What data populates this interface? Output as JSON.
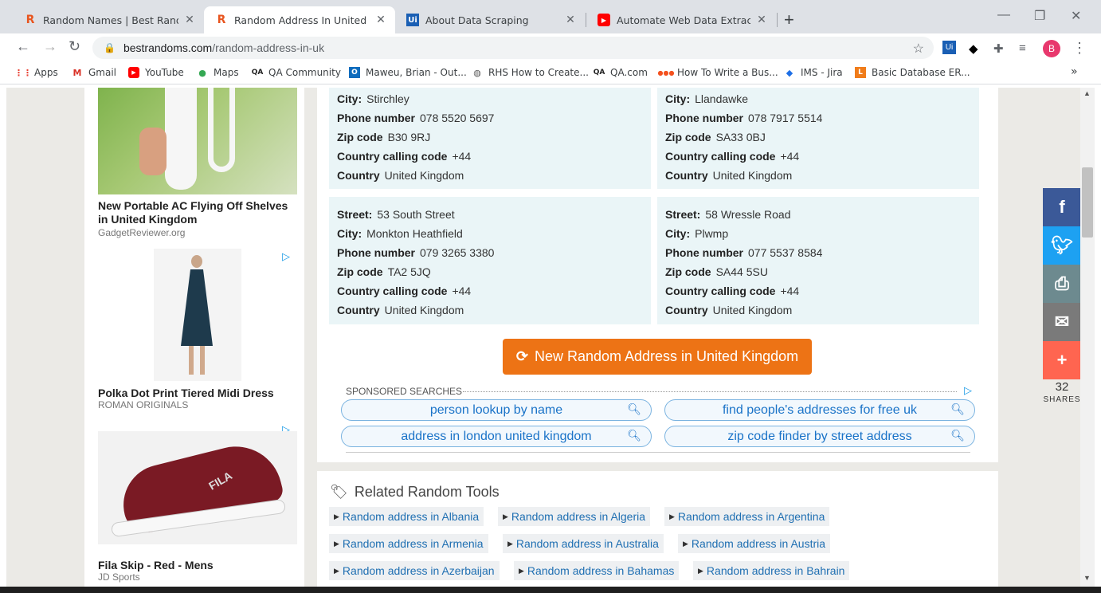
{
  "tabs": [
    {
      "favicon": "R",
      "title": "Random Names | Best Random T",
      "close": "✕"
    },
    {
      "favicon": "R",
      "title": "Random Address In United Kingd",
      "close": "✕"
    },
    {
      "favicon": "Ui",
      "title": "About Data Scraping",
      "close": "✕"
    },
    {
      "favicon": "▶",
      "title": "Automate Web Data Extraction -",
      "close": "✕"
    }
  ],
  "new_tab": "+",
  "window_controls": {
    "minimize": "—",
    "maximize": "❐",
    "close": "✕"
  },
  "address": {
    "host": "bestrandoms.com",
    "path": "/random-address-in-uk"
  },
  "bookmarks": [
    {
      "icon": "apps-icon",
      "label": "Apps"
    },
    {
      "icon": "gmail-icon",
      "label": "Gmail"
    },
    {
      "icon": "youtube-icon",
      "label": "YouTube"
    },
    {
      "icon": "maps-icon",
      "label": "Maps"
    },
    {
      "icon": "qa-icon",
      "label": "QA Community"
    },
    {
      "icon": "outlook-icon",
      "label": "Maweu, Brian - Out..."
    },
    {
      "icon": "globe-icon",
      "label": "RHS How to Create..."
    },
    {
      "icon": "qa-icon",
      "label": "QA.com"
    },
    {
      "icon": "dots-icon",
      "label": "How To Write a Bus..."
    },
    {
      "icon": "ims-icon",
      "label": "IMS - Jira"
    },
    {
      "icon": "db-icon",
      "label": "Basic Database ER..."
    }
  ],
  "bookmarks_more": "»",
  "ads": [
    {
      "title": "New Portable AC Flying Off Shelves in United Kingdom",
      "source": "GadgetReviewer.org"
    },
    {
      "title": "Polka Dot Print Tiered Midi Dress",
      "source": "ROMAN ORIGINALS"
    },
    {
      "title": "Fila Skip - Red - Mens",
      "source": "JD Sports"
    }
  ],
  "labels": {
    "street": "Street:",
    "city": "City:",
    "phone": "Phone number",
    "zip": "Zip code",
    "calling": "Country calling code",
    "country": "Country"
  },
  "addresses": [
    {
      "city": "Stirchley",
      "phone": "078 5520 5697",
      "zip": "B30 9RJ",
      "calling": "+44",
      "country": "United Kingdom"
    },
    {
      "city": "Llandawke",
      "phone": "078 7917 5514",
      "zip": "SA33 0BJ",
      "calling": "+44",
      "country": "United Kingdom"
    },
    {
      "street": "53 South Street",
      "city": "Monkton Heathfield",
      "phone": "079 3265 3380",
      "zip": "TA2 5JQ",
      "calling": "+44",
      "country": "United Kingdom"
    },
    {
      "street": "58 Wressle Road",
      "city": "Plwmp",
      "phone": "077 5537 8584",
      "zip": "SA44 5SU",
      "calling": "+44",
      "country": "United Kingdom"
    }
  ],
  "new_button": "New Random Address in United Kingdom",
  "sponsored_label": "SPONSORED SEARCHES",
  "sponsored": [
    "person lookup by name",
    "find people's addresses for free uk",
    "address in london united kingdom",
    "zip code finder by street address"
  ],
  "related_title": "Related Random Tools",
  "related": [
    "Random address in Albania",
    "Random address in Algeria",
    "Random address in Argentina",
    "Random address in Armenia",
    "Random address in Australia",
    "Random address in Austria",
    "Random address in Azerbaijan",
    "Random address in Bahamas",
    "Random address in Bahrain"
  ],
  "share": {
    "count": "32",
    "label": "SHARES"
  },
  "colors": {
    "accent": "#ed7315",
    "facebook": "#3b5998",
    "twitter": "#1da1f2",
    "print": "#6d8a8f",
    "email": "#7a7a7a",
    "more": "#ff6550"
  }
}
